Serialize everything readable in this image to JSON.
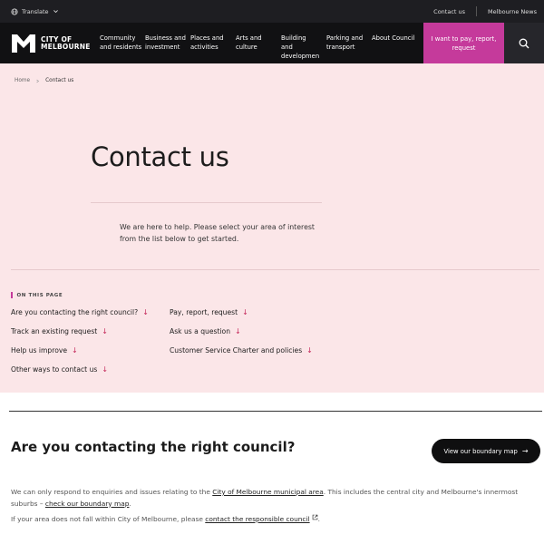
{
  "utility": {
    "translate_label": "Translate",
    "contact_label": "Contact us",
    "news_label": "Melbourne News"
  },
  "logo": {
    "line1": "CITY OF",
    "line2": "MELBOURNE"
  },
  "nav": {
    "items": [
      {
        "label": "Community and residents"
      },
      {
        "label": "Business and investment"
      },
      {
        "label": "Places and activities"
      },
      {
        "label": "Arts and culture"
      },
      {
        "label": "Building and development"
      },
      {
        "label": "Parking and transport"
      },
      {
        "label": "About Council"
      }
    ],
    "cta_label": "I want to pay, report, request"
  },
  "breadcrumb": {
    "home": "Home",
    "current": "Contact us"
  },
  "hero": {
    "title": "Contact us",
    "intro": "We are here to help. Please select your area of interest from the list below to get started.",
    "on_this_page": "ON THIS PAGE",
    "links": [
      {
        "label": "Are you contacting the right council?"
      },
      {
        "label": "Pay, report, request"
      },
      {
        "label": "Track an existing request"
      },
      {
        "label": "Ask us a question"
      },
      {
        "label": "Help us improve"
      },
      {
        "label": "Customer Service Charter and policies"
      },
      {
        "label": "Other ways to contact us"
      }
    ]
  },
  "section": {
    "heading": "Are you contacting the right council?",
    "button_label": "View our boundary map",
    "p1_a": "We can only respond to enquiries and issues relating to the ",
    "p1_link1": "City of Melbourne municipal area",
    "p1_b": ". This includes the central city and Melbourne's innermost suburbs – ",
    "p1_link2": "check our boundary map",
    "p1_c": ".",
    "p2_a": "If your area does not fall within City of Melbourne, please ",
    "p2_link": "contact the responsible council",
    "p2_b": "."
  },
  "colors": {
    "accent": "#c53a9b",
    "hero_bg": "#fbe6e8",
    "nav_bg": "#111113"
  }
}
